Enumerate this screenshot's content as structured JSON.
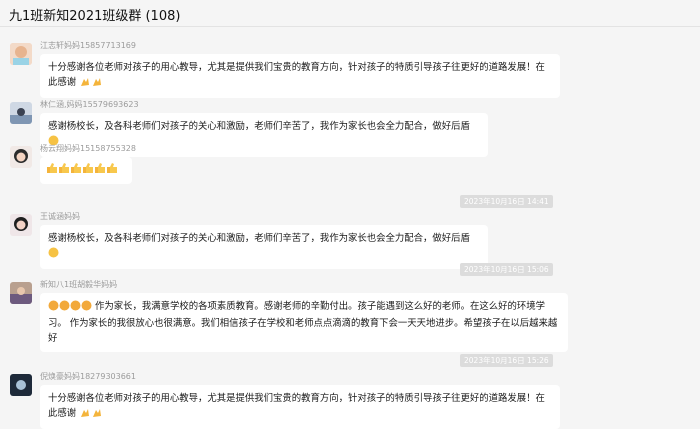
{
  "header": {
    "title": "九1班新知2021班级群 (108)"
  },
  "messages": [
    {
      "sender": "江志轩妈妈15857713169",
      "text": "十分感谢各位老师对孩子的用心教导，尤其是提供我们宝贵的教育方向，针对孩子的特质引导孩子往更好的道路发展！在此感谢",
      "emoji": [
        "clap-hands",
        "clap-hands"
      ]
    },
    {
      "sender": "林仁涵,妈妈15579693623",
      "text": "感谢杨校长，及各科老师们对孩子的关心和激励，老师们辛苦了，我作为家长也会全力配合，做好后盾",
      "emoji": [
        "fist"
      ]
    },
    {
      "sender": "杨云翔妈妈15158755328",
      "text": "",
      "emoji": [
        "thumbs-up",
        "thumbs-up",
        "thumbs-up",
        "thumbs-up",
        "thumbs-up",
        "thumbs-up"
      ]
    },
    {
      "time": "2023年10月16日 14:41",
      "sender": "王诚涵妈妈",
      "text": "感谢杨校长，及各科老师们对孩子的关心和激励，老师们辛苦了，我作为家长也会全力配合，做好后盾",
      "emoji": [
        "fist"
      ]
    },
    {
      "time": "2023年10月16日 15:06",
      "sender": "新知八1班胡毅华妈妈",
      "text": "作为家长，我满意学校的各项素质教育。感谢老师的辛勤付出。孩子能遇到这么好的老师。在这么好的环境学习。 作为家长的我很放心也很满意。我们相信孩子在学校和老师点点滴滴的教育下会一天天地进步。希望孩子在以后越来越好",
      "emoji": [
        "clap",
        "clap",
        "clap",
        "clap"
      ]
    },
    {
      "time": "2023年10月16日 15:26",
      "sender": "倪焕豪妈妈18279303661",
      "text": "十分感谢各位老师对孩子的用心教导，尤其是提供我们宝贵的教育方向，针对孩子的特质引导孩子往更好的道路发展！在此感谢",
      "emoji": [
        "clap-hands",
        "clap-hands"
      ]
    }
  ]
}
